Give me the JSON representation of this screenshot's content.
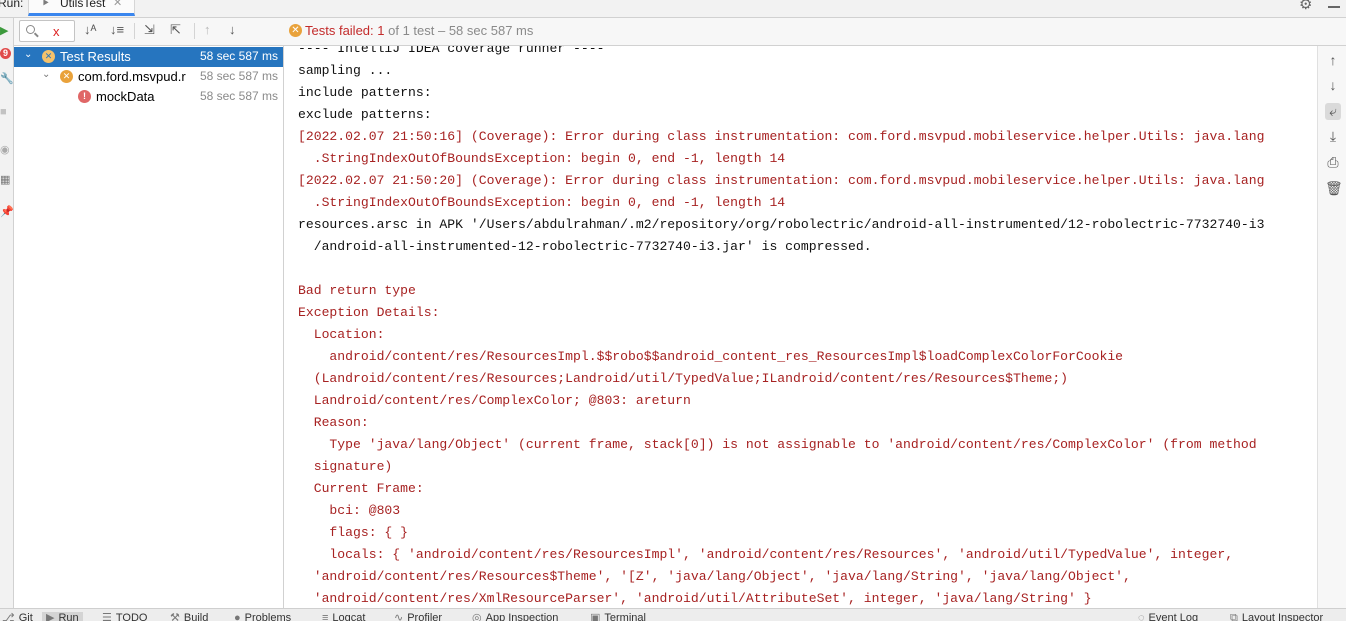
{
  "window": {
    "run_label": "Run:",
    "tab_title": "UtilsTest"
  },
  "toolbar": {
    "search_value": "x",
    "status_failed": "Tests failed: 1",
    "status_rest": " of 1 test – 58 sec 587 ms"
  },
  "left_strip": {
    "fail_count": "9"
  },
  "tree": {
    "items": [
      {
        "label": "Test Results",
        "time": "58 sec 587 ms",
        "status": "warning"
      },
      {
        "label": "com.ford.msvpud.r",
        "time": "58 sec 587 ms",
        "status": "warning"
      },
      {
        "label": "mockData",
        "time": "58 sec 587 ms",
        "status": "error"
      }
    ]
  },
  "console": {
    "lines": [
      {
        "text": "---- IntelliJ IDEA coverage runner ----",
        "kind": "std"
      },
      {
        "text": "sampling ...",
        "kind": "std"
      },
      {
        "text": "include patterns:",
        "kind": "std"
      },
      {
        "text": "exclude patterns:",
        "kind": "std"
      },
      {
        "text": "[2022.02.07 21:50:16] (Coverage): Error during class instrumentation: com.ford.msvpud.mobileservice.helper.Utils: java.lang",
        "kind": "err"
      },
      {
        "text": "  .StringIndexOutOfBoundsException: begin 0, end -1, length 14",
        "kind": "err"
      },
      {
        "text": "[2022.02.07 21:50:20] (Coverage): Error during class instrumentation: com.ford.msvpud.mobileservice.helper.Utils: java.lang",
        "kind": "err"
      },
      {
        "text": "  .StringIndexOutOfBoundsException: begin 0, end -1, length 14",
        "kind": "err"
      },
      {
        "text": "resources.arsc in APK '/Users/abdulrahman/.m2/repository/org/robolectric/android-all-instrumented/12-robolectric-7732740-i3",
        "kind": "std"
      },
      {
        "text": "  /android-all-instrumented-12-robolectric-7732740-i3.jar' is compressed.",
        "kind": "std"
      },
      {
        "text": "",
        "kind": "std"
      },
      {
        "text": "Bad return type",
        "kind": "err"
      },
      {
        "text": "Exception Details:",
        "kind": "err"
      },
      {
        "text": "  Location:",
        "kind": "err"
      },
      {
        "text": "    android/content/res/ResourcesImpl.$$robo$$android_content_res_ResourcesImpl$loadComplexColorForCookie",
        "kind": "err"
      },
      {
        "text": "  (Landroid/content/res/Resources;Landroid/util/TypedValue;ILandroid/content/res/Resources$Theme;)",
        "kind": "err"
      },
      {
        "text": "  Landroid/content/res/ComplexColor; @803: areturn",
        "kind": "err"
      },
      {
        "text": "  Reason:",
        "kind": "err"
      },
      {
        "text": "    Type 'java/lang/Object' (current frame, stack[0]) is not assignable to 'android/content/res/ComplexColor' (from method",
        "kind": "err"
      },
      {
        "text": "  signature)",
        "kind": "err"
      },
      {
        "text": "  Current Frame:",
        "kind": "err"
      },
      {
        "text": "    bci: @803",
        "kind": "err"
      },
      {
        "text": "    flags: { }",
        "kind": "err"
      },
      {
        "text": "    locals: { 'android/content/res/ResourcesImpl', 'android/content/res/Resources', 'android/util/TypedValue', integer,",
        "kind": "err"
      },
      {
        "text": "  'android/content/res/Resources$Theme', '[Z', 'java/lang/Object', 'java/lang/String', 'java/lang/Object',",
        "kind": "err"
      },
      {
        "text": "  'android/content/res/XmlResourceParser', 'android/util/AttributeSet', integer, 'java/lang/String' }",
        "kind": "err"
      }
    ]
  },
  "bottom_tabs": [
    {
      "label": "Git",
      "icon": "git-icon"
    },
    {
      "label": "Run",
      "icon": "play-icon",
      "active": true
    },
    {
      "label": "TODO",
      "icon": "list-icon"
    },
    {
      "label": "Build",
      "icon": "hammer-icon"
    },
    {
      "label": "Problems",
      "icon": "problems-icon"
    },
    {
      "label": "Logcat",
      "icon": "logcat-icon"
    },
    {
      "label": "Profiler",
      "icon": "profiler-icon"
    },
    {
      "label": "App Inspection",
      "icon": "inspection-icon"
    },
    {
      "label": "Terminal",
      "icon": "terminal-icon"
    },
    {
      "label": "Event Log",
      "icon": "event-log-icon"
    },
    {
      "label": "Layout Inspector",
      "icon": "layout-inspector-icon"
    }
  ],
  "colors": {
    "error_text": "#a72222",
    "selection": "#2675bf",
    "warning": "#e9a23b",
    "failed_status": "#c32b2b"
  }
}
